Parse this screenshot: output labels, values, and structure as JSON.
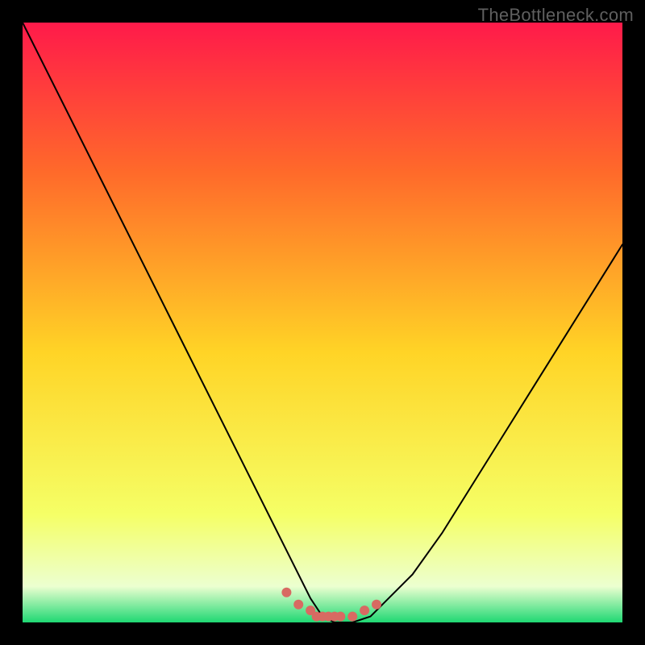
{
  "watermark": "TheBottleneck.com",
  "colors": {
    "frame_bg": "#000000",
    "curve_stroke": "#000000",
    "marker_fill": "#d86a62",
    "grad_top": "#ff1a4a",
    "grad_mid_upper": "#ff6a2a",
    "grad_mid": "#ffd426",
    "grad_lower": "#f5ff66",
    "grad_bottom_pale": "#ecffd0",
    "grad_bottom": "#1fd873"
  },
  "chart_data": {
    "type": "line",
    "title": "",
    "xlabel": "",
    "ylabel": "",
    "xlim": [
      0,
      100
    ],
    "ylim": [
      0,
      100
    ],
    "legend": false,
    "grid": false,
    "series": [
      {
        "name": "bottleneck-curve",
        "x": [
          0,
          5,
          10,
          15,
          20,
          25,
          30,
          35,
          40,
          45,
          48,
          50,
          52,
          55,
          58,
          60,
          65,
          70,
          75,
          80,
          85,
          90,
          95,
          100
        ],
        "values": [
          100,
          90,
          80,
          70,
          60,
          50,
          40,
          30,
          20,
          10,
          4,
          1,
          0,
          0,
          1,
          3,
          8,
          15,
          23,
          31,
          39,
          47,
          55,
          63
        ]
      }
    ],
    "markers": {
      "name": "trough-markers",
      "x": [
        44,
        46,
        48,
        49,
        50,
        51,
        52,
        53,
        55,
        57,
        59
      ],
      "values": [
        5,
        3,
        2,
        1,
        1,
        1,
        1,
        1,
        1,
        2,
        3
      ]
    },
    "background_gradient": {
      "direction": "vertical",
      "stops": [
        {
          "pos": 0.0,
          "hint": "red-pink"
        },
        {
          "pos": 0.25,
          "hint": "orange"
        },
        {
          "pos": 0.55,
          "hint": "yellow"
        },
        {
          "pos": 0.82,
          "hint": "pale-yellow"
        },
        {
          "pos": 0.94,
          "hint": "near-white"
        },
        {
          "pos": 1.0,
          "hint": "green"
        }
      ]
    }
  }
}
